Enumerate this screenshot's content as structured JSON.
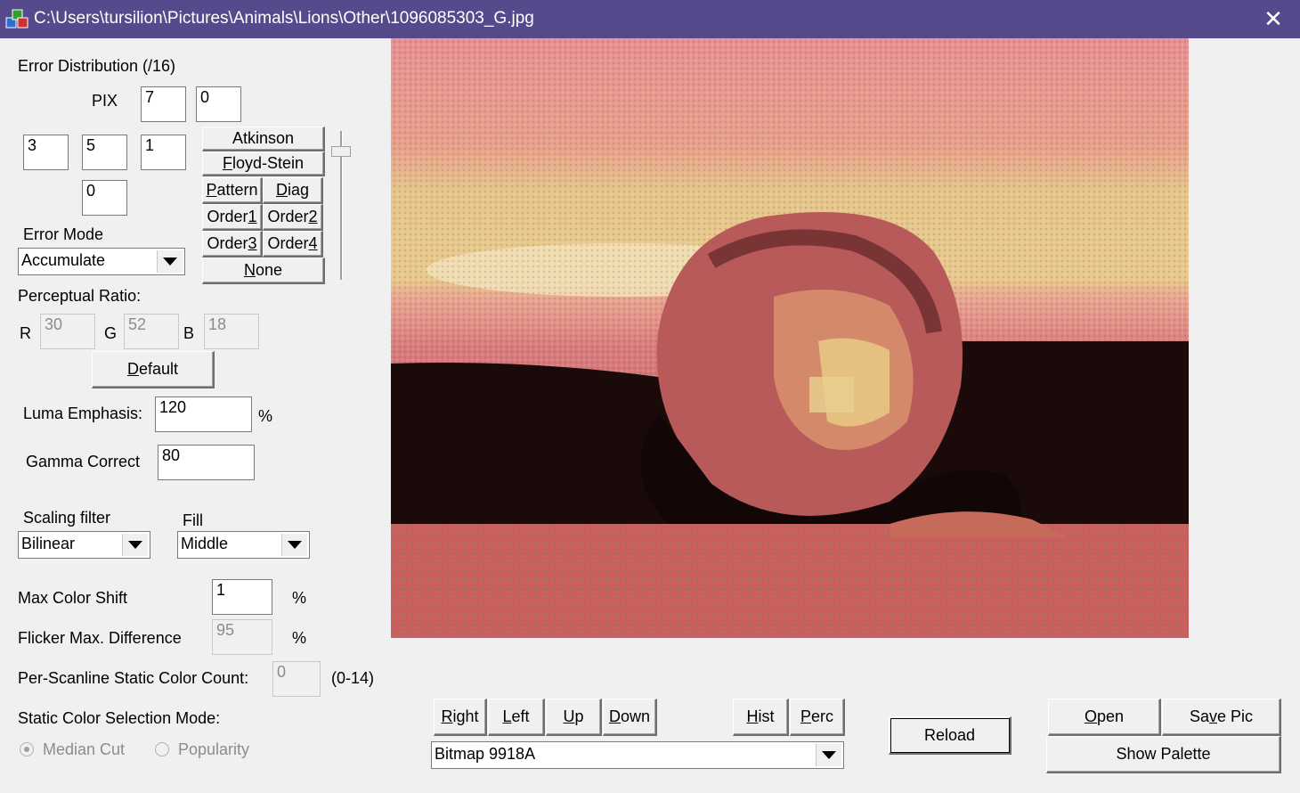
{
  "window": {
    "title": "C:\\Users\\tursilion\\Pictures\\Animals\\Lions\\Other\\1096085303_G.jpg",
    "close_glyph": "✕",
    "titlebar_color": "#564a8c"
  },
  "error_distribution": {
    "heading": "Error Distribution (/16)",
    "pix_label": "PIX",
    "values": {
      "r0c2": "7",
      "r0c3": "0",
      "r1c0": "3",
      "r1c1": "5",
      "r1c2": "1",
      "r2c1": "0"
    }
  },
  "presets": {
    "atkinson": "Atkinson",
    "floyd": {
      "pre": "",
      "ul": "F",
      "post": "loyd-Stein"
    },
    "pattern": {
      "pre": "",
      "ul": "P",
      "post": "attern"
    },
    "diag": {
      "pre": "",
      "ul": "D",
      "post": "iag"
    },
    "order1": {
      "pre": "Order",
      "ul": "1",
      "post": ""
    },
    "order2": {
      "pre": "Order",
      "ul": "2",
      "post": ""
    },
    "order3": {
      "pre": "Order",
      "ul": "3",
      "post": ""
    },
    "order4": {
      "pre": "Order",
      "ul": "4",
      "post": ""
    },
    "none": {
      "pre": "",
      "ul": "N",
      "post": "one"
    }
  },
  "error_mode": {
    "label": "Error Mode",
    "value": "Accumulate"
  },
  "perceptual": {
    "label": "Perceptual Ratio:",
    "r_label": "R",
    "r": "30",
    "g_label": "G",
    "g": "52",
    "b_label": "B",
    "b": "18",
    "default": {
      "pre": "",
      "ul": "D",
      "post": "efault"
    }
  },
  "luma": {
    "label": "Luma Emphasis:",
    "value": "120",
    "unit": "%"
  },
  "gamma": {
    "label": "Gamma Correct",
    "value": "80"
  },
  "scaling": {
    "label": "Scaling filter",
    "value": "Bilinear"
  },
  "fill": {
    "label": "Fill",
    "value": "Middle"
  },
  "max_shift": {
    "label": "Max Color Shift",
    "value": "1",
    "unit": "%"
  },
  "flicker": {
    "label": "Flicker Max. Difference",
    "value": "95",
    "unit": "%"
  },
  "scanline": {
    "label": "Per-Scanline Static Color Count:",
    "value": "0",
    "range": "(0-14)"
  },
  "static_mode": {
    "label": "Static Color Selection Mode:",
    "median": "Median Cut",
    "popularity": "Popularity",
    "selected": "median"
  },
  "nav": {
    "right": {
      "pre": "",
      "ul": "R",
      "post": "ight"
    },
    "left": {
      "pre": "",
      "ul": "L",
      "post": "eft"
    },
    "up": {
      "pre": "",
      "ul": "U",
      "post": "p"
    },
    "down": {
      "pre": "",
      "ul": "D",
      "post": "own"
    },
    "hist": {
      "pre": "",
      "ul": "H",
      "post": "ist"
    },
    "perc": {
      "pre": "",
      "ul": "P",
      "post": "erc"
    }
  },
  "mode_select": {
    "value": "Bitmap 9918A"
  },
  "actions": {
    "reload": "Reload",
    "open": {
      "pre": "",
      "ul": "O",
      "post": "pen"
    },
    "save": {
      "pre": "Sa",
      "ul": "v",
      "post": "e Pic"
    },
    "show_palette": "Show Palette"
  },
  "image": {
    "description_icon": "dithered-lion-image"
  }
}
